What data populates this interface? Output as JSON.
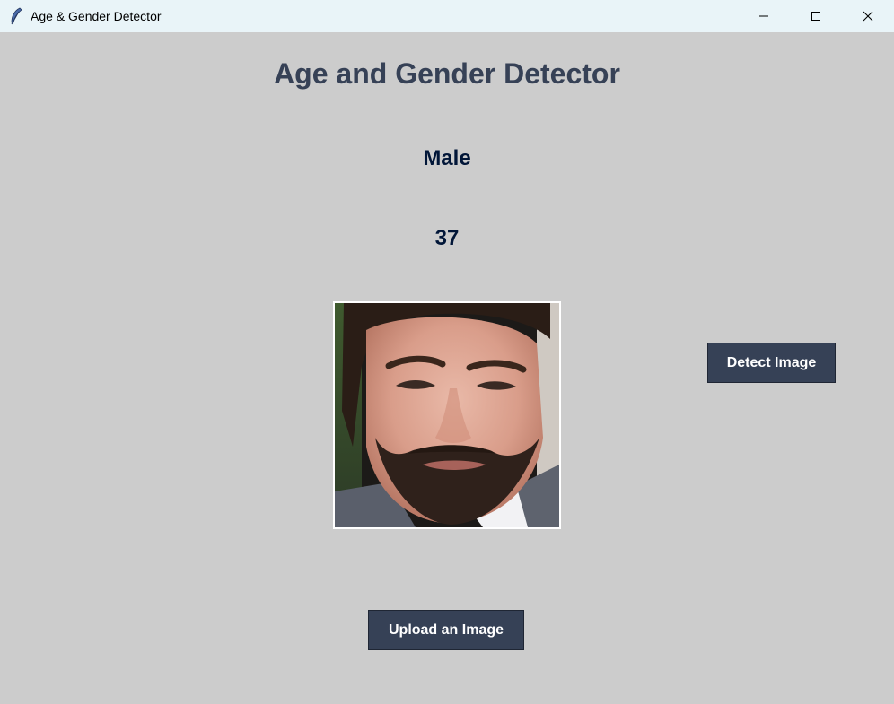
{
  "window": {
    "title": "Age & Gender Detector",
    "icon": "feather-icon"
  },
  "main": {
    "heading": "Age and Gender Detector",
    "gender_result": "Male",
    "age_result": "37",
    "photo": "face-photo"
  },
  "buttons": {
    "detect_label": "Detect Image",
    "upload_label": "Upload an Image"
  },
  "colors": {
    "background": "#cccccc",
    "heading": "#364156",
    "result_text": "#011638",
    "button_bg": "#364156",
    "button_text": "#ffffff"
  }
}
